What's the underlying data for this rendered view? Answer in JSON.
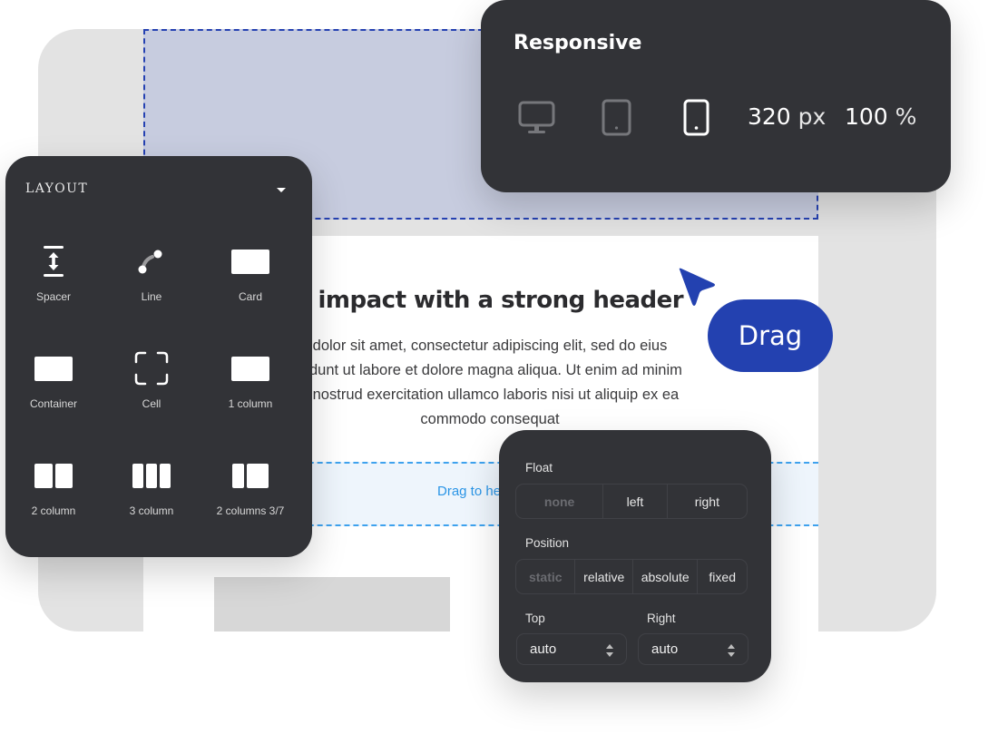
{
  "canvas": {
    "headline": "an impact with a strong header",
    "body_lines": [
      "dolor sit amet, consectetur adipiscing elit, sed do eius",
      "didunt ut labore et dolore magna aliqua. Ut enim ad minim",
      "s nostrud exercitation ullamco laboris nisi ut aliquip ex ea",
      "commodo consequat"
    ],
    "drop_hint": "Drag to he"
  },
  "layout_panel": {
    "title": "LAYOUT",
    "items": [
      {
        "label": "Spacer",
        "icon": "spacer-icon"
      },
      {
        "label": "Line",
        "icon": "line-icon"
      },
      {
        "label": "Card",
        "icon": "card-icon"
      },
      {
        "label": "Container",
        "icon": "container-icon"
      },
      {
        "label": "Cell",
        "icon": "cell-icon"
      },
      {
        "label": "1 column",
        "icon": "one-column-icon"
      },
      {
        "label": "2 column",
        "icon": "two-column-icon"
      },
      {
        "label": "3 column",
        "icon": "three-column-icon"
      },
      {
        "label": "2 columns 3/7",
        "icon": "two-columns-3-7-icon"
      }
    ]
  },
  "responsive_panel": {
    "title": "Responsive",
    "devices": [
      {
        "name": "desktop",
        "active": false
      },
      {
        "name": "tablet",
        "active": false
      },
      {
        "name": "mobile",
        "active": true
      }
    ],
    "width_value": "320",
    "width_unit": "px",
    "zoom_value": "100",
    "zoom_unit": "%"
  },
  "drag_badge": {
    "label": "Drag",
    "color": "#2341b0"
  },
  "properties_panel": {
    "float": {
      "label": "Float",
      "options": [
        "none",
        "left",
        "right"
      ],
      "selected": "none"
    },
    "position": {
      "label": "Position",
      "options": [
        "static",
        "relative",
        "absolute",
        "fixed"
      ],
      "selected": "static"
    },
    "top": {
      "label": "Top",
      "value": "auto"
    },
    "right": {
      "label": "Right",
      "value": "auto"
    }
  },
  "colors": {
    "accent": "#2341b0",
    "panel_bg": "#323337",
    "drop_hint": "#2b95e6",
    "header_zone": "#c7ccdf"
  }
}
